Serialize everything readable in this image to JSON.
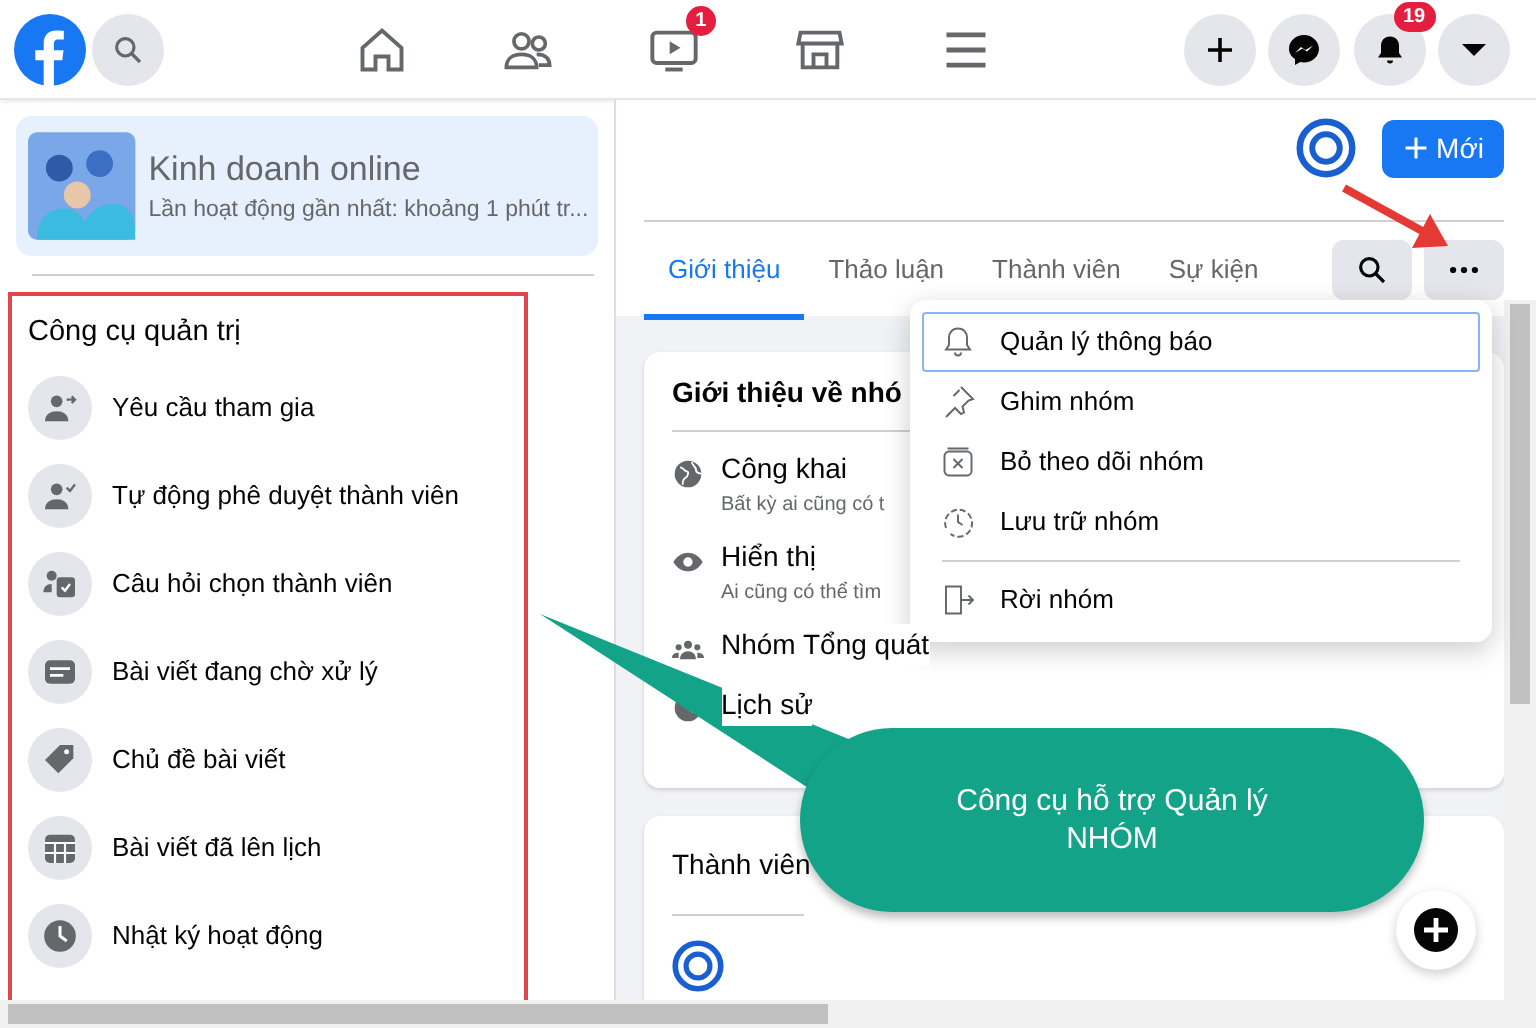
{
  "top_nav": {
    "video_badge": "1",
    "notifications_badge": "19"
  },
  "group": {
    "name": "Kinh doanh online",
    "activity": "Lần hoạt động gần nhất: khoảng 1 phút tr..."
  },
  "admin_tools": {
    "title": "Công cụ quản trị",
    "items": [
      {
        "label": "Yêu cầu tham gia",
        "kind": "join"
      },
      {
        "label": "Tự động phê duyệt thành viên",
        "kind": "approve"
      },
      {
        "label": "Câu hỏi chọn thành viên",
        "kind": "question"
      },
      {
        "label": "Bài viết đang chờ xử lý",
        "kind": "pending"
      },
      {
        "label": "Chủ đề bài viết",
        "kind": "tag"
      },
      {
        "label": "Bài viết đã lên lịch",
        "kind": "calendar"
      },
      {
        "label": "Nhật ký hoạt động",
        "kind": "clock"
      }
    ]
  },
  "new_button": "Mới",
  "tabs": [
    {
      "label": "Giới thiệu",
      "selected": true
    },
    {
      "label": "Thảo luận",
      "selected": false
    },
    {
      "label": "Thành viên",
      "selected": false
    },
    {
      "label": "Sự kiện",
      "selected": false
    }
  ],
  "menu": [
    {
      "label": "Quản lý thông báo",
      "kind": "bell",
      "selected": true
    },
    {
      "label": "Ghim nhóm",
      "kind": "pin",
      "selected": false
    },
    {
      "label": "Bỏ theo dõi nhóm",
      "kind": "unfollow",
      "selected": false
    },
    {
      "label": "Lưu trữ nhóm",
      "kind": "archive",
      "selected": false
    },
    {
      "label": "Rời nhóm",
      "kind": "leave",
      "selected": false
    }
  ],
  "about": {
    "title": "Giới thiệu về nhó",
    "rows": [
      {
        "kind": "globe",
        "title": "Công khai",
        "description": "Bất kỳ ai cũng có t"
      },
      {
        "kind": "eye",
        "title": "Hiển thị",
        "description": "Ai cũng có thể tìm"
      },
      {
        "kind": "people",
        "title": "Nhóm Tổng quát"
      },
      {
        "kind": "clock",
        "title": "Lịch sử"
      }
    ]
  },
  "members": {
    "title": "Thành viên"
  },
  "callout": "Công cụ hỗ trợ Quản lý NHÓM"
}
